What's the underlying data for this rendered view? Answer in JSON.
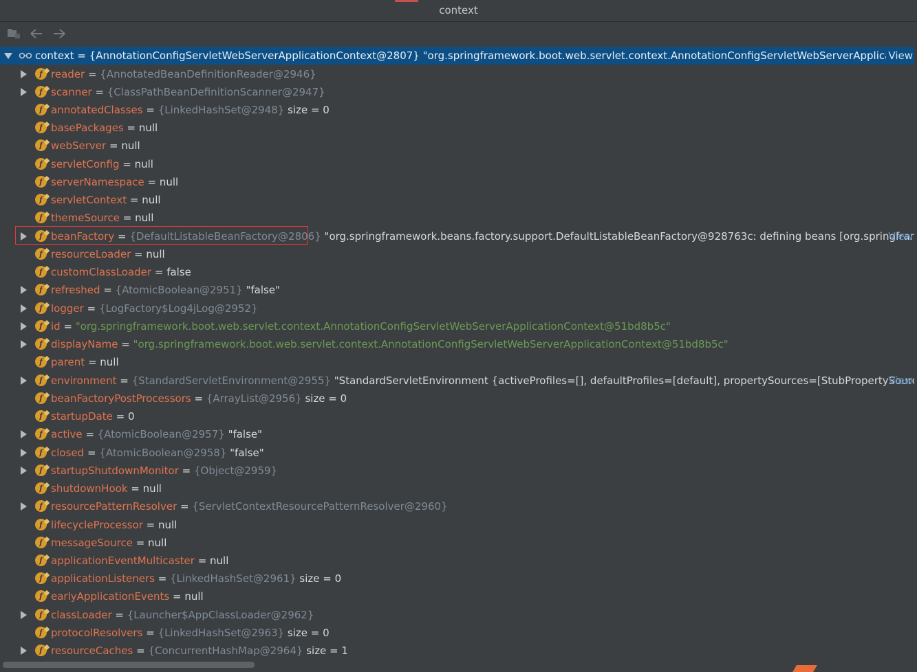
{
  "window": {
    "title": "context"
  },
  "toolbar": {
    "buttons": [
      {
        "icon": "folder-structure-icon"
      },
      {
        "icon": "back-arrow-icon"
      },
      {
        "icon": "forward-arrow-icon"
      }
    ]
  },
  "root": {
    "name": "context",
    "eq": " = ",
    "ref": "{AnnotationConfigServletWebServerApplicationContext@2807}",
    "value": " \"org.springframework.boot.web.servlet.context.AnnotationConfigServletWebServerApplicati...",
    "view": "View"
  },
  "rows": [
    {
      "expandable": true,
      "name": "reader",
      "ref": "{AnnotatedBeanDefinitionReader@2946}"
    },
    {
      "expandable": true,
      "name": "scanner",
      "ref": "{ClassPathBeanDefinitionScanner@2947}"
    },
    {
      "expandable": false,
      "name": "annotatedClasses",
      "ref": "{LinkedHashSet@2948}",
      "value": "  size = 0"
    },
    {
      "expandable": false,
      "name": "basePackages",
      "value": "null"
    },
    {
      "expandable": false,
      "name": "webServer",
      "value": "null"
    },
    {
      "expandable": false,
      "name": "servletConfig",
      "value": "null"
    },
    {
      "expandable": false,
      "name": "serverNamespace",
      "value": "null"
    },
    {
      "expandable": false,
      "name": "servletContext",
      "value": "null"
    },
    {
      "expandable": false,
      "name": "themeSource",
      "value": "null"
    },
    {
      "expandable": true,
      "name": "beanFactory",
      "ref": "{DefaultListableBeanFactory@2806}",
      "value": " \"org.springframework.beans.factory.support.DefaultListableBeanFactory@928763c: defining beans [org.springfran...",
      "view": "View"
    },
    {
      "expandable": false,
      "name": "resourceLoader",
      "value": "null"
    },
    {
      "expandable": false,
      "name": "customClassLoader",
      "value": "false"
    },
    {
      "expandable": true,
      "name": "refreshed",
      "ref": "{AtomicBoolean@2951}",
      "value": " \"false\""
    },
    {
      "expandable": true,
      "name": "logger",
      "ref": "{LogFactory$Log4jLog@2952}"
    },
    {
      "expandable": true,
      "name": "id",
      "str": "\"org.springframework.boot.web.servlet.context.AnnotationConfigServletWebServerApplicationContext@51bd8b5c\""
    },
    {
      "expandable": true,
      "name": "displayName",
      "str": "\"org.springframework.boot.web.servlet.context.AnnotationConfigServletWebServerApplicationContext@51bd8b5c\""
    },
    {
      "expandable": false,
      "name": "parent",
      "value": "null"
    },
    {
      "expandable": true,
      "name": "environment",
      "ref": "{StandardServletEnvironment@2955}",
      "value": " \"StandardServletEnvironment {activeProfiles=[], defaultProfiles=[default], propertySources=[StubPropertySourc...",
      "view": "View"
    },
    {
      "expandable": false,
      "name": "beanFactoryPostProcessors",
      "ref": "{ArrayList@2956}",
      "value": "  size = 0"
    },
    {
      "expandable": false,
      "name": "startupDate",
      "value": "0"
    },
    {
      "expandable": true,
      "name": "active",
      "ref": "{AtomicBoolean@2957}",
      "value": " \"false\""
    },
    {
      "expandable": true,
      "name": "closed",
      "ref": "{AtomicBoolean@2958}",
      "value": " \"false\""
    },
    {
      "expandable": true,
      "name": "startupShutdownMonitor",
      "ref": "{Object@2959}"
    },
    {
      "expandable": false,
      "name": "shutdownHook",
      "value": "null"
    },
    {
      "expandable": true,
      "name": "resourcePatternResolver",
      "ref": "{ServletContextResourcePatternResolver@2960}"
    },
    {
      "expandable": false,
      "name": "lifecycleProcessor",
      "value": "null"
    },
    {
      "expandable": false,
      "name": "messageSource",
      "value": "null"
    },
    {
      "expandable": false,
      "name": "applicationEventMulticaster",
      "value": "null"
    },
    {
      "expandable": false,
      "name": "applicationListeners",
      "ref": "{LinkedHashSet@2961}",
      "value": "  size = 0"
    },
    {
      "expandable": false,
      "name": "earlyApplicationEvents",
      "value": "null"
    },
    {
      "expandable": true,
      "name": "classLoader",
      "ref": "{Launcher$AppClassLoader@2962}"
    },
    {
      "expandable": false,
      "name": "protocolResolvers",
      "ref": "{LinkedHashSet@2963}",
      "value": "  size = 0"
    },
    {
      "expandable": true,
      "name": "resourceCaches",
      "ref": "{ConcurrentHashMap@2964}",
      "value": "  size = 1"
    }
  ],
  "field_icon_letter": "f",
  "colors": {
    "background": "#3c3f41",
    "selection": "#0d4f84",
    "field_name": "#e0734f",
    "reference": "#7f8b97",
    "string": "#6a9955",
    "link": "#5a8fc6",
    "highlight_box": "#e03b3b"
  }
}
